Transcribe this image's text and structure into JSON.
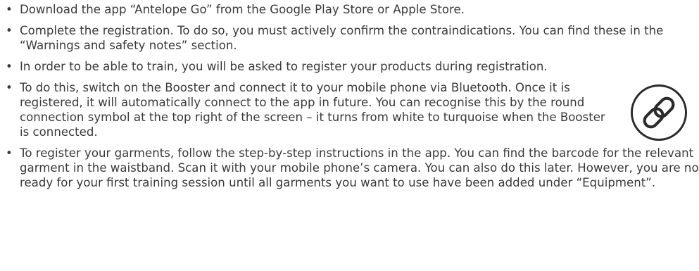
{
  "bullet_glyph": "•",
  "items": [
    {
      "text": "Download the app “Antelope Go” from the Google Play Store or Apple Store."
    },
    {
      "text": "Complete the registration. To do so, you must actively confirm the contraindications. You can find these in the “Warnings and safety notes” section."
    },
    {
      "text": "In order to be able to train, you will be asked to register your products during registration."
    },
    {
      "text": "To do this, switch on the Booster and connect it to your mobile phone via Bluetooth. Once it is registered, it will automatically connect to the app in future. You can recognise this by the round connection symbol at the top right of the screen – it turns from white to turquoise when the Booster is connected.",
      "icon": "link-chain-icon"
    },
    {
      "text": "To register your garments, follow the step-by-step instructions in the app. You can find the barcode for the relevant garment in the waistband. Scan it with your mobile phone’s camera. You can also do this later. However, you are not ready for your first training session until all garments you want to use have been added under “Equipment”."
    }
  ],
  "colors": {
    "text": "#3a3a3a",
    "icon_stroke": "#2b2b2b"
  }
}
